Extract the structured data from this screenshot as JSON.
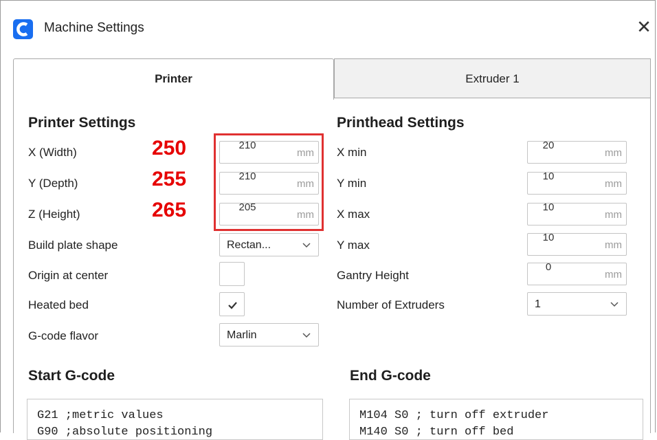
{
  "window": {
    "title": "Machine Settings",
    "close_symbol": "✕",
    "accent_color": "#196ef0"
  },
  "tabs": [
    {
      "label": "Printer",
      "active": true
    },
    {
      "label": "Extruder 1",
      "active": false
    }
  ],
  "printer_settings": {
    "title": "Printer Settings",
    "x_width": {
      "label": "X (Width)",
      "value": "210",
      "unit": "mm",
      "annotation": "250"
    },
    "y_depth": {
      "label": "Y (Depth)",
      "value": "210",
      "unit": "mm",
      "annotation": "255"
    },
    "z_height": {
      "label": "Z (Height)",
      "value": "205",
      "unit": "mm",
      "annotation": "265"
    },
    "build_plate_shape": {
      "label": "Build plate shape",
      "value": "Rectan..."
    },
    "origin_at_center": {
      "label": "Origin at center",
      "checked": false
    },
    "heated_bed": {
      "label": "Heated bed",
      "checked": true
    },
    "gcode_flavor": {
      "label": "G-code flavor",
      "value": "Marlin"
    }
  },
  "printhead_settings": {
    "title": "Printhead Settings",
    "x_min": {
      "label": "X min",
      "value": "20",
      "unit": "mm"
    },
    "y_min": {
      "label": "Y min",
      "value": "10",
      "unit": "mm"
    },
    "x_max": {
      "label": "X max",
      "value": "10",
      "unit": "mm"
    },
    "y_max": {
      "label": "Y max",
      "value": "10",
      "unit": "mm"
    },
    "gantry_height": {
      "label": "Gantry Height",
      "value": "0",
      "unit": "mm"
    },
    "number_of_extruders": {
      "label": "Number of Extruders",
      "value": "1"
    }
  },
  "start_gcode": {
    "title": "Start G-code",
    "lines": [
      "G21 ;metric values",
      "G90 ;absolute positioning"
    ]
  },
  "end_gcode": {
    "title": "End G-code",
    "lines": [
      "M104 S0 ; turn off extruder",
      "M140 S0 ; turn off bed"
    ]
  },
  "annotation_color": "#e60000"
}
